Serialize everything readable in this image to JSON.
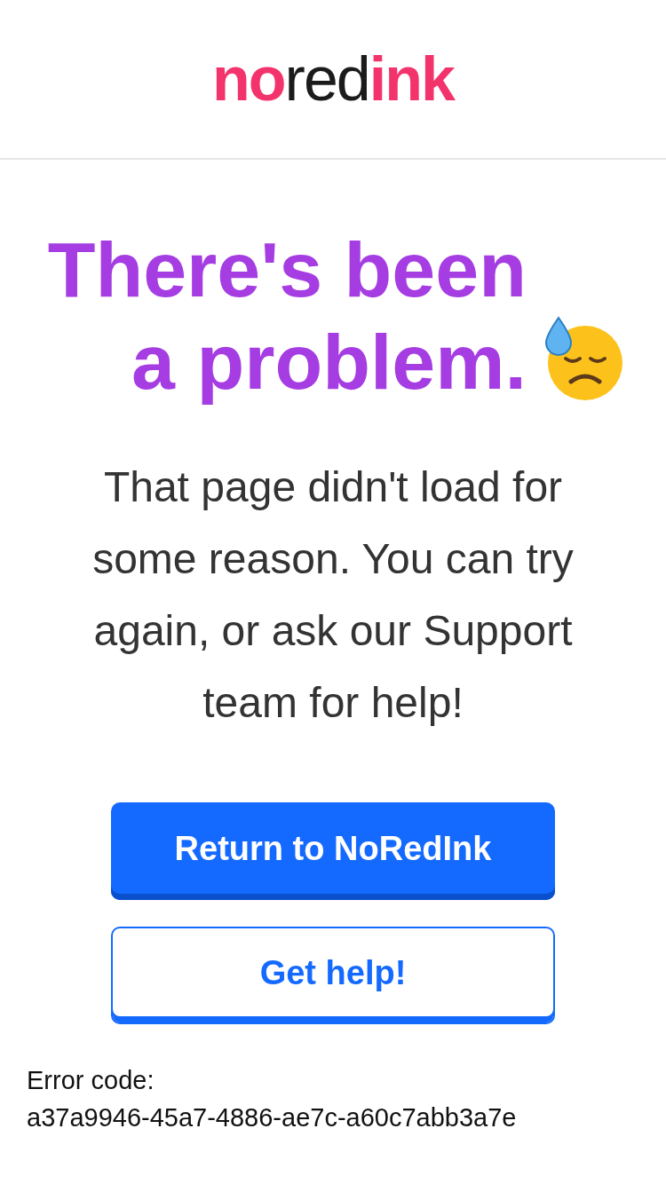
{
  "header": {
    "logo": [
      {
        "text": "no",
        "kind": "accent"
      },
      {
        "text": "red",
        "kind": "plain"
      },
      {
        "text": "ink",
        "kind": "accent"
      }
    ]
  },
  "headline": "There's been a problem.",
  "message": "That page didn't load for some reason. You can try again, or ask our Support team for help!",
  "buttons": [
    {
      "label": "Return to NoRedInk",
      "kind": "primary"
    },
    {
      "label": "Get help!",
      "kind": "secondary"
    }
  ],
  "error": {
    "label": "Error code:",
    "code": "a37a9946-45a7-4886-ae7c-a60c7abb3a7e"
  }
}
